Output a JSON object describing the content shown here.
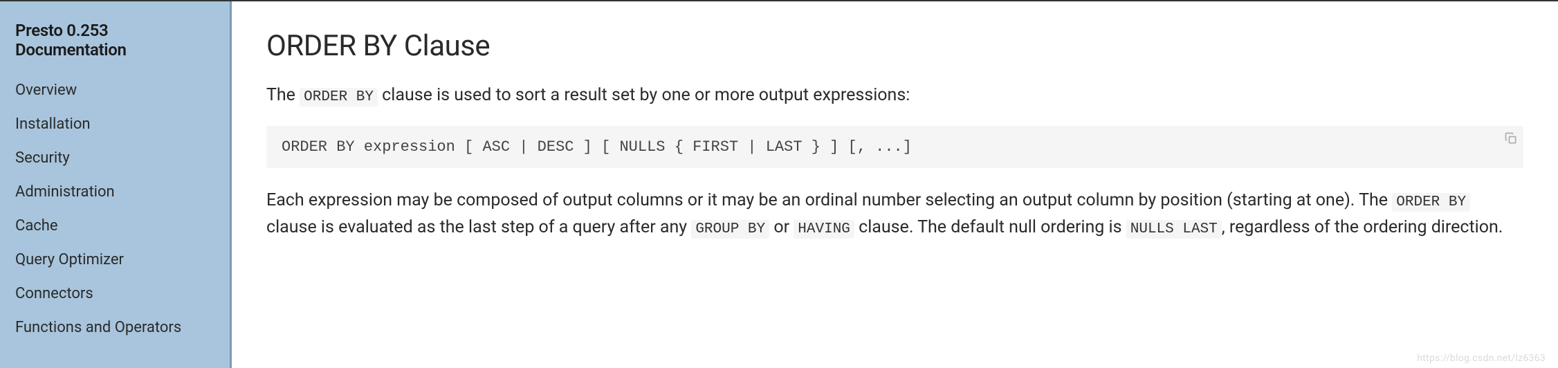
{
  "sidebar": {
    "title": "Presto 0.253 Documentation",
    "items": [
      {
        "label": "Overview"
      },
      {
        "label": "Installation"
      },
      {
        "label": "Security"
      },
      {
        "label": "Administration"
      },
      {
        "label": "Cache"
      },
      {
        "label": "Query Optimizer"
      },
      {
        "label": "Connectors"
      },
      {
        "label": "Functions and Operators"
      }
    ]
  },
  "main": {
    "heading": "ORDER BY Clause",
    "intro_prefix": "The ",
    "intro_code": "ORDER BY",
    "intro_suffix": " clause is used to sort a result set by one or more output expressions:",
    "code_block": "ORDER BY expression [ ASC | DESC ] [ NULLS { FIRST | LAST } ] [, ...]",
    "body_part1": "Each expression may be composed of output columns or it may be an ordinal number selecting an output column by position (starting at one). The ",
    "body_code1": "ORDER BY",
    "body_part2": " clause is evaluated as the last step of a query after any ",
    "body_code2": "GROUP BY",
    "body_part3": " or ",
    "body_code3": "HAVING",
    "body_part4": " clause. The default null ordering is ",
    "body_code4": "NULLS LAST",
    "body_part5": ", regardless of the ordering direction."
  },
  "watermark": "https://blog.csdn.net/lz6363"
}
